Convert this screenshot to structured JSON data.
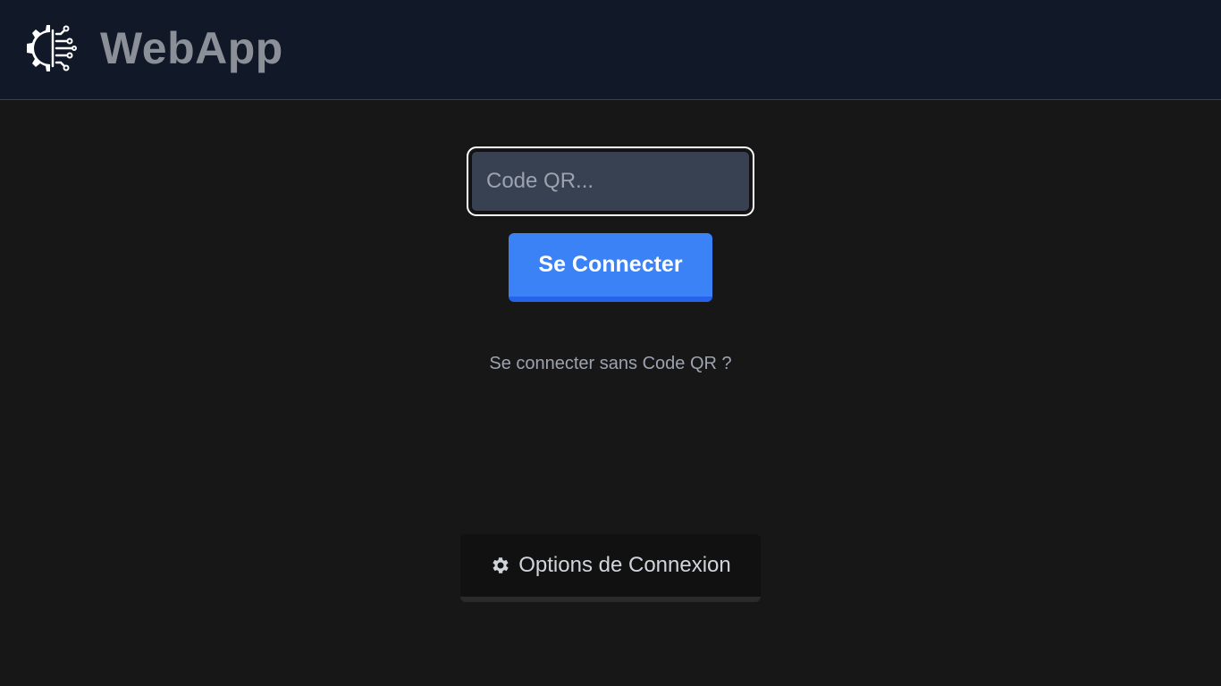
{
  "header": {
    "brand": "WebApp",
    "logo_icon": "gear-circuit-logo-icon"
  },
  "login": {
    "qr_placeholder": "Code QR...",
    "qr_value": "",
    "connect_label": "Se Connecter",
    "no_qr_link": "Se connecter sans Code QR ?"
  },
  "options": {
    "label": "Options de Connexion",
    "icon": "gear-icon"
  },
  "colors": {
    "header_bg": "#111827",
    "page_bg": "#171717",
    "primary": "#3b82f6",
    "input_bg": "#374151"
  }
}
